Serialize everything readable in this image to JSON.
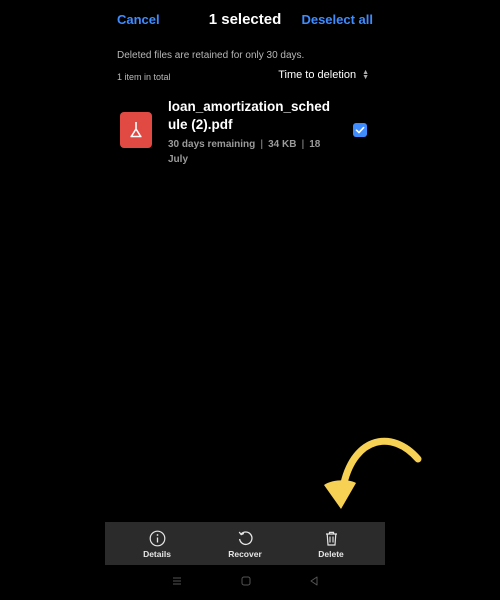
{
  "header": {
    "cancel_label": "Cancel",
    "title": "1 selected",
    "deselect_label": "Deselect all"
  },
  "info": {
    "retention_notice": "Deleted files are retained for only 30 days.",
    "item_count": "1 item in total",
    "sort_label": "Time to deletion"
  },
  "file": {
    "name": "loan_amortization_schedule (2).pdf",
    "remaining": "30 days remaining",
    "size": "34 KB",
    "date": "18 July",
    "icon": "pdf-file-icon",
    "selected": true
  },
  "actions": {
    "details_label": "Details",
    "recover_label": "Recover",
    "delete_label": "Delete"
  },
  "colors": {
    "accent": "#3f8cff",
    "pdf_red": "#e04a43",
    "annotation_arrow": "#f7d154",
    "action_bar_bg": "#2b2b2b"
  }
}
